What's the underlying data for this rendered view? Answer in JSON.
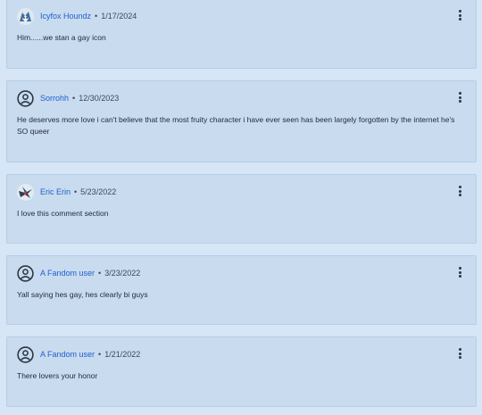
{
  "comments": [
    {
      "author": "Icyfox Houndz",
      "separator": "•",
      "date": "1/17/2024",
      "avatar": "fox-avatar",
      "text": "Him......we stan a gay icon"
    },
    {
      "author": "Sorrohh",
      "separator": "•",
      "date": "12/30/2023",
      "avatar": "default-user-icon",
      "text": "He deserves more love i can't believe that the most fruity character i have ever seen has been largely forgotten by the internet he's SO queer"
    },
    {
      "author": "Eric Erin",
      "separator": "•",
      "date": "5/23/2022",
      "avatar": "bird-avatar",
      "text": "I love this comment section"
    },
    {
      "author": "A Fandom user",
      "separator": "•",
      "date": "3/23/2022",
      "avatar": "default-user-icon",
      "text": "Yall saying hes gay, hes clearly bi guys"
    },
    {
      "author": "A Fandom user",
      "separator": "•",
      "date": "1/21/2022",
      "avatar": "default-user-icon",
      "text": "There lovers your honor"
    }
  ],
  "colors": {
    "background": "#d6e6f7",
    "card": "#c9dbee",
    "link": "#1f5fd1",
    "text": "#1e2a3a"
  }
}
